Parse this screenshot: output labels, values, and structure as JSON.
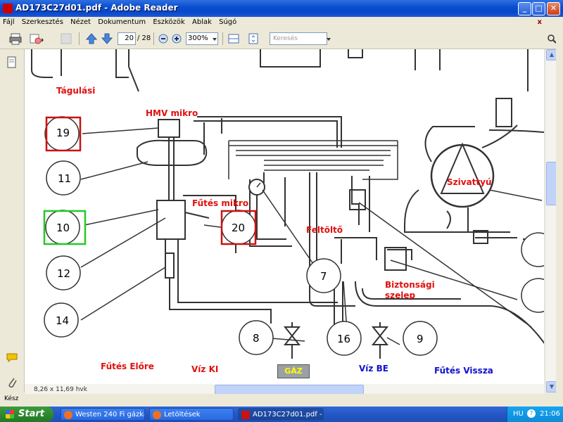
{
  "window": {
    "title": "AD173C27d01.pdf - Adobe Reader",
    "buttons": {
      "minimize": "_",
      "maximize": "□",
      "close": "✕"
    }
  },
  "menubar": {
    "items": [
      "Fájl",
      "Szerkesztés",
      "Nézet",
      "Dokumentum",
      "Eszközök",
      "Ablak",
      "Súgó"
    ],
    "close": "x"
  },
  "toolbar": {
    "current_page": "20",
    "page_count": "/ 28",
    "zoom": "300%",
    "search_placeholder": "Keresés"
  },
  "diagram": {
    "labels": {
      "tagulasi": "Tágulási",
      "hmv_mikro": "HMV mikro",
      "futes_mikro": "Fűtés mikro",
      "szivattyu": "Szivattyú",
      "feltolto": "Feltöltő",
      "biztonsagi_1": "Biztonsági",
      "biztonsagi_2": "szelep",
      "futes_elore": "Fűtés Előre",
      "viz_ki": "Víz KI",
      "gaz": "GÁZ",
      "viz_be": "Víz BE",
      "futes_vissza": "Fűtés Vissza"
    },
    "numbers": {
      "n19": "19",
      "n11": "11",
      "n10": "10",
      "n12": "12",
      "n14": "14",
      "n20": "20",
      "n7": "7",
      "n8": "8",
      "n16": "16",
      "n9": "9"
    }
  },
  "statusbar": {
    "page_size": "8,26 x 11,69 hvk",
    "status_text": "Kész"
  },
  "taskbar": {
    "start": "Start",
    "tasks": [
      "Westen 240 Fi gázka...",
      "Letöltések",
      "AD173C27d01.pdf - ..."
    ],
    "lang": "HU",
    "clock": "21:06"
  },
  "colors": {
    "red_label": "#e01010",
    "blue_label": "#1111cc",
    "highlight_red": "#cc1111",
    "highlight_green": "#22cc22"
  }
}
